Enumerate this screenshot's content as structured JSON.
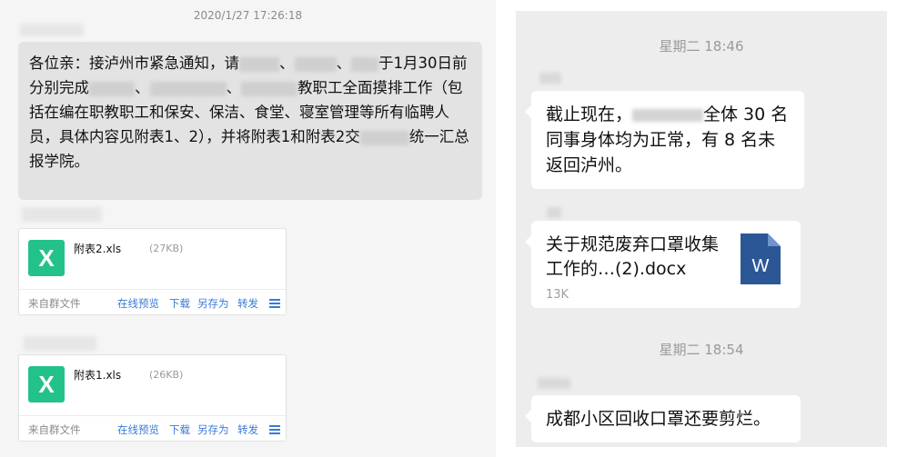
{
  "left_chat": {
    "timestamp": "2020/1/27 17:26:18",
    "message": {
      "p1": "各位亲：接泸州市紧急通知，请",
      "p2": "、",
      "p3": "、",
      "p4": "于1月30日前分别完成",
      "p5": "、",
      "p6": "、",
      "p7": "教职工全面摸排工作（包括在编在职教职工和保安、保洁、食堂、寝室管理等所有临聘人员，具体内容见附表1、2），并将附表1和附表2交",
      "p8": "统一汇总报学院。"
    },
    "files": [
      {
        "name": "附表2.xls",
        "size": "(27KB)",
        "source": "来自群文件",
        "actions": [
          "在线预览",
          "下载",
          "另存为",
          "转发"
        ]
      },
      {
        "name": "附表1.xls",
        "size": "(26KB)",
        "source": "来自群文件",
        "actions": [
          "在线预览",
          "下载",
          "另存为",
          "转发"
        ]
      }
    ],
    "file_icon_letter": "X",
    "file_icon_color": "#23c28a",
    "link_color": "#3a7bd5"
  },
  "right_chat": {
    "messages": [
      {
        "time": "星期二 18:46",
        "text_a": "截止现在，",
        "text_b": "全体 30 名同事身体均为正常，有 8 名未返回泸州。"
      },
      {
        "doc_name": "关于规范废弃口罩收集工作的…(2).docx",
        "doc_size": "13K",
        "doc_icon_letter": "W"
      },
      {
        "time": "星期二 18:54",
        "text": "成都小区回收口罩还要剪烂。"
      }
    ]
  }
}
